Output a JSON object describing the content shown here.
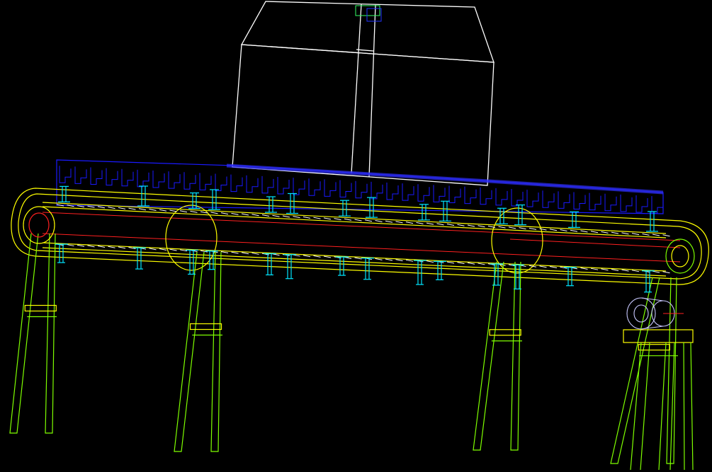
{
  "view": {
    "background": "#000000",
    "subject": "conveyor-wireframe"
  },
  "colors": {
    "box": "#ffffff",
    "belt_pattern": "#1a1aff",
    "frame_outline": "#ffff00",
    "legs": "#7fff00",
    "rollers": "#00e5ff",
    "tension_line": "#ff2020",
    "pulley": "#c8c8ff"
  },
  "components": {
    "leg_count": 4,
    "roller_pairs": 18,
    "drive_unit": true
  }
}
